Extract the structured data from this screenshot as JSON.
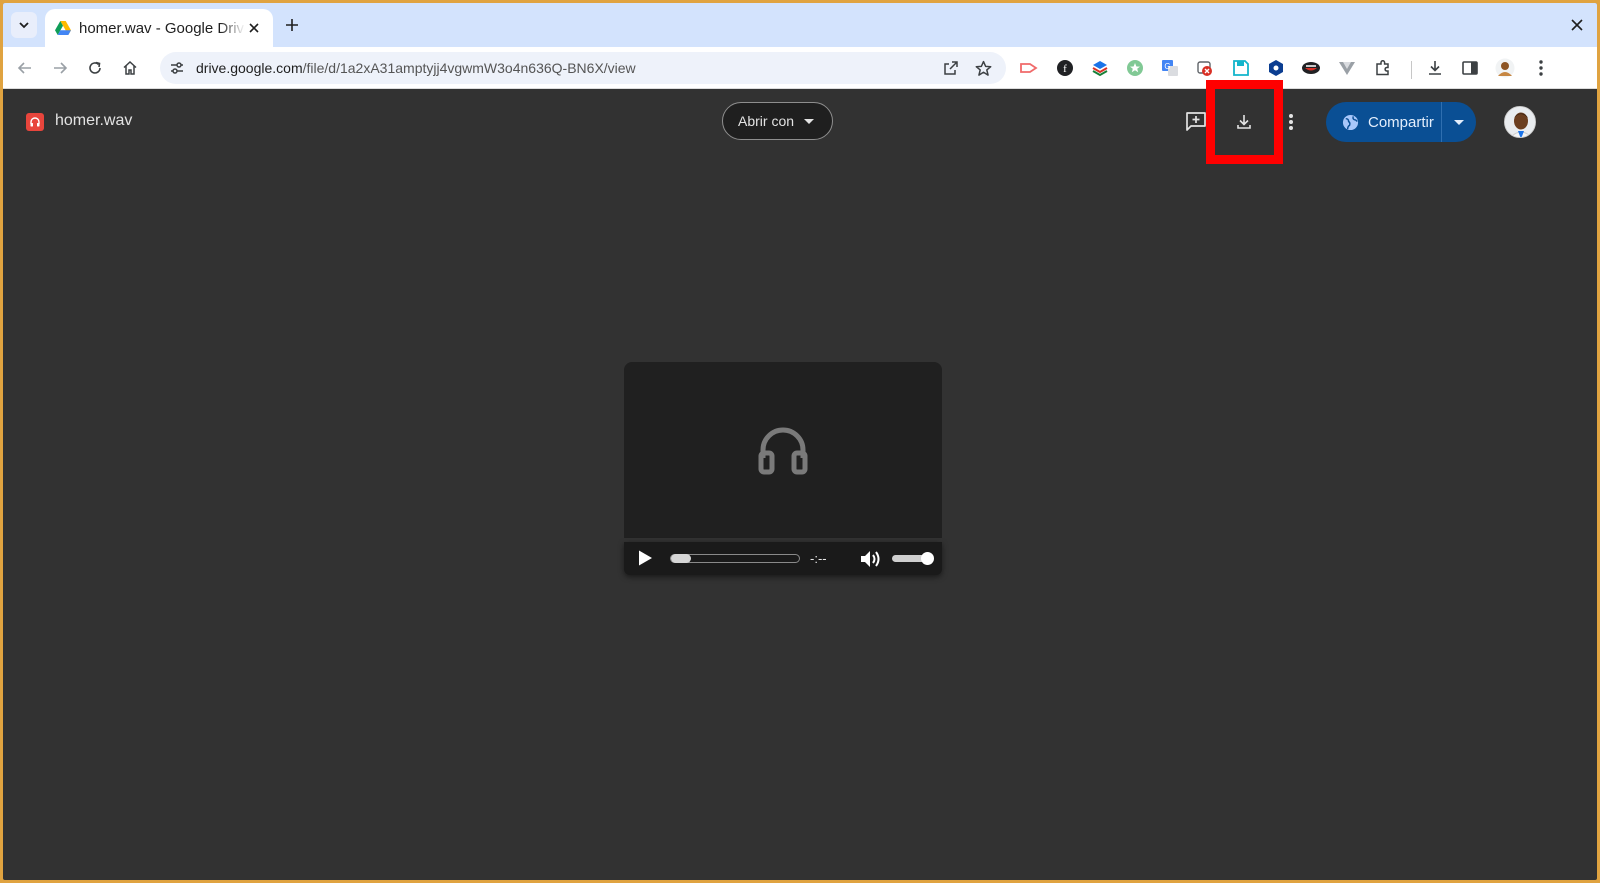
{
  "browser": {
    "tab": {
      "title": "homer.wav - Google Drive",
      "favicon": "google-drive-icon"
    },
    "address": {
      "host": "drive.google.com",
      "path": "/file/d/1a2xA31amptyjj4vgwmW3o4n636Q-BN6X/view"
    },
    "icons": {
      "tab_list": "chevron-down-icon",
      "new_tab": "plus-icon",
      "close_window": "close-icon",
      "back": "arrow-left-icon",
      "forward": "arrow-right-icon",
      "reload": "reload-icon",
      "home": "home-icon",
      "site_info": "tune-icon",
      "open_in_app": "open-external-icon",
      "bookmark": "star-icon",
      "downloads": "download-icon",
      "side_panel": "side-panel-icon",
      "menu": "kebab-icon"
    },
    "extensions": [
      "extension-pink-arrow-icon",
      "extension-circle-f-icon",
      "extension-layers-icon",
      "extension-green-star-icon",
      "extension-translate-icon",
      "extension-red-block-icon",
      "extension-save-icon",
      "extension-hex-icon",
      "extension-face-icon",
      "extension-v-icon",
      "extensions-puzzle-icon"
    ]
  },
  "viewer": {
    "file_name": "homer.wav",
    "file_icon": "headphones-icon",
    "open_with_label": "Abrir con",
    "icons": {
      "add_comment": "add-comment-icon",
      "download": "download-icon",
      "more": "more-vert-icon"
    },
    "share_label": "Compartir",
    "share_icon": "globe-icon"
  },
  "player": {
    "art_icon": "headphones-icon",
    "time": "-:--",
    "progress": 0,
    "volume": 1.0,
    "icons": {
      "play": "play-icon",
      "volume": "volume-icon"
    }
  },
  "colors": {
    "viewer_bg": "#323232",
    "share_bg": "#0a4f94",
    "highlight": "#ff0000",
    "tab_strip": "#d3e3fd",
    "desktop_border": "#e0a340"
  }
}
